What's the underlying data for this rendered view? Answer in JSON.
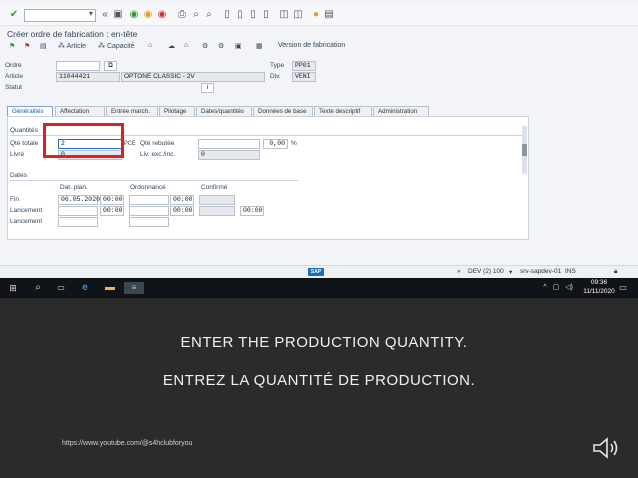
{
  "window": {
    "title": "Créer ordre de fabrication : en-tête"
  },
  "toolbar": {
    "check_icon": "check-icon",
    "command_field_value": ""
  },
  "app_toolbar": {
    "article_label": "Article",
    "capacite_label": "Capacité",
    "version_label": "Version de fabrication"
  },
  "header": {
    "ordre_label": "Ordre",
    "ordre_value": "",
    "article_label": "Article",
    "article_value": "11044421",
    "article_desc": "OPTONE CLASSIC - 2V",
    "statut_label": "Statut",
    "type_label": "Type",
    "type_value": "PP01",
    "div_label": "Div.",
    "div_value": "VENI"
  },
  "tabs": [
    {
      "label": "Généralités",
      "active": true
    },
    {
      "label": "Affectation"
    },
    {
      "label": "Entrée march."
    },
    {
      "label": "Pilotage"
    },
    {
      "label": "Dates/quantités"
    },
    {
      "label": "Données de base"
    },
    {
      "label": "Texte descriptif"
    },
    {
      "label": "Administration"
    }
  ],
  "quantities": {
    "group_title": "Quantités",
    "qte_totale_label": "Qté totale",
    "qte_totale_value": "2",
    "unit": "PCE",
    "qte_rebutee_label": "Qté rebutée",
    "qte_rebutee_value": "0,00",
    "percent": "%",
    "livre_label": "Livré",
    "livre_value": "0",
    "liv_exc_label": "Liv. exc./inc.",
    "liv_exc_value": "0"
  },
  "dates": {
    "group_title": "Dates",
    "col_plan": "Dat. plan.",
    "col_ordonnance": "Ordonnancé",
    "col_confirme": "Confirmé",
    "fin_label": "Fin",
    "fin_date": "06.05.2020",
    "fin_time": "00:00",
    "fin_ord_time": "00:00",
    "lancement_label": "Lancement",
    "lancement_time": "00:00",
    "lancement_ord_time": "00:00",
    "lancement_conf_time": "00:00",
    "lancement2_label": "Lancement"
  },
  "statusbar": {
    "sap_logo": "SAP",
    "system": "DEV (2) 100",
    "server": "srv-sapdev-01",
    "mode": "INS"
  },
  "taskbar": {
    "time": "09:36",
    "date": "11/11/2020"
  },
  "caption": {
    "line1": "ENTER THE PRODUCTION QUANTITY.",
    "line2": "ENTREZ LA QUANTITÉ DE PRODUCTION.",
    "url": "https://www.youtube.com/@s4hclubforyou"
  },
  "colors": {
    "highlight": "#e02020",
    "sap_blue": "#1d6fb8"
  }
}
